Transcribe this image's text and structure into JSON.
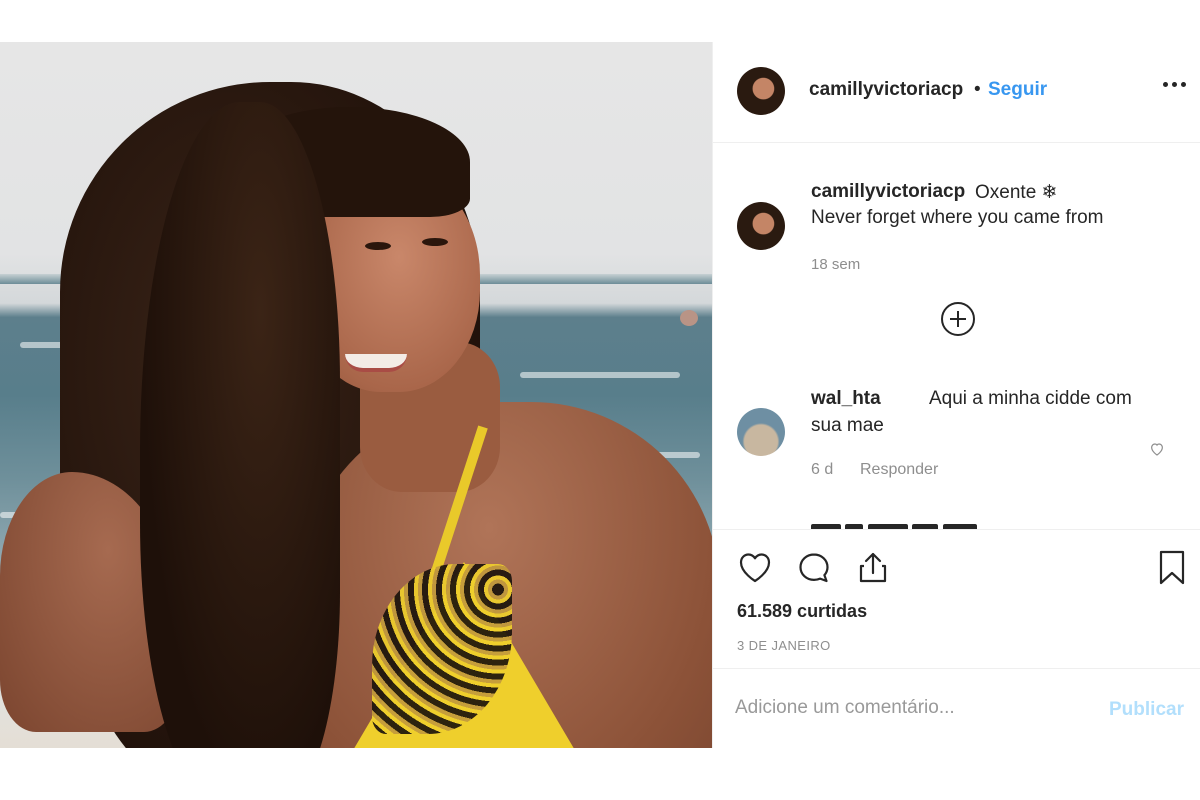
{
  "header": {
    "username": "camillyvictoriacp",
    "separator": "•",
    "follow_label": "Seguir"
  },
  "caption": {
    "username": "camillyvictoriacp",
    "text_line1": "Oxente ❄",
    "text_line2": "Never forget where you came from",
    "time": "18 sem"
  },
  "comments": [
    {
      "username": "wal_hta",
      "text_line1": "Aqui a minha cidde com",
      "text_line2": "sua mae",
      "time": "6 d",
      "reply_label": "Responder"
    }
  ],
  "actions": {
    "likes": "61.589 curtidas",
    "date": "3 DE JANEIRO"
  },
  "add_comment": {
    "placeholder": "Adicione um comentário...",
    "publish_label": "Publicar"
  },
  "colors": {
    "accent": "#3897f0",
    "publish_disabled": "#b2dffc",
    "text": "#262626",
    "muted": "#8e8e8e",
    "bikini": "#efcf2c"
  },
  "icons": [
    "more-options-icon",
    "load-more-plus-icon",
    "heart-icon",
    "comment-icon",
    "share-icon",
    "bookmark-icon"
  ]
}
